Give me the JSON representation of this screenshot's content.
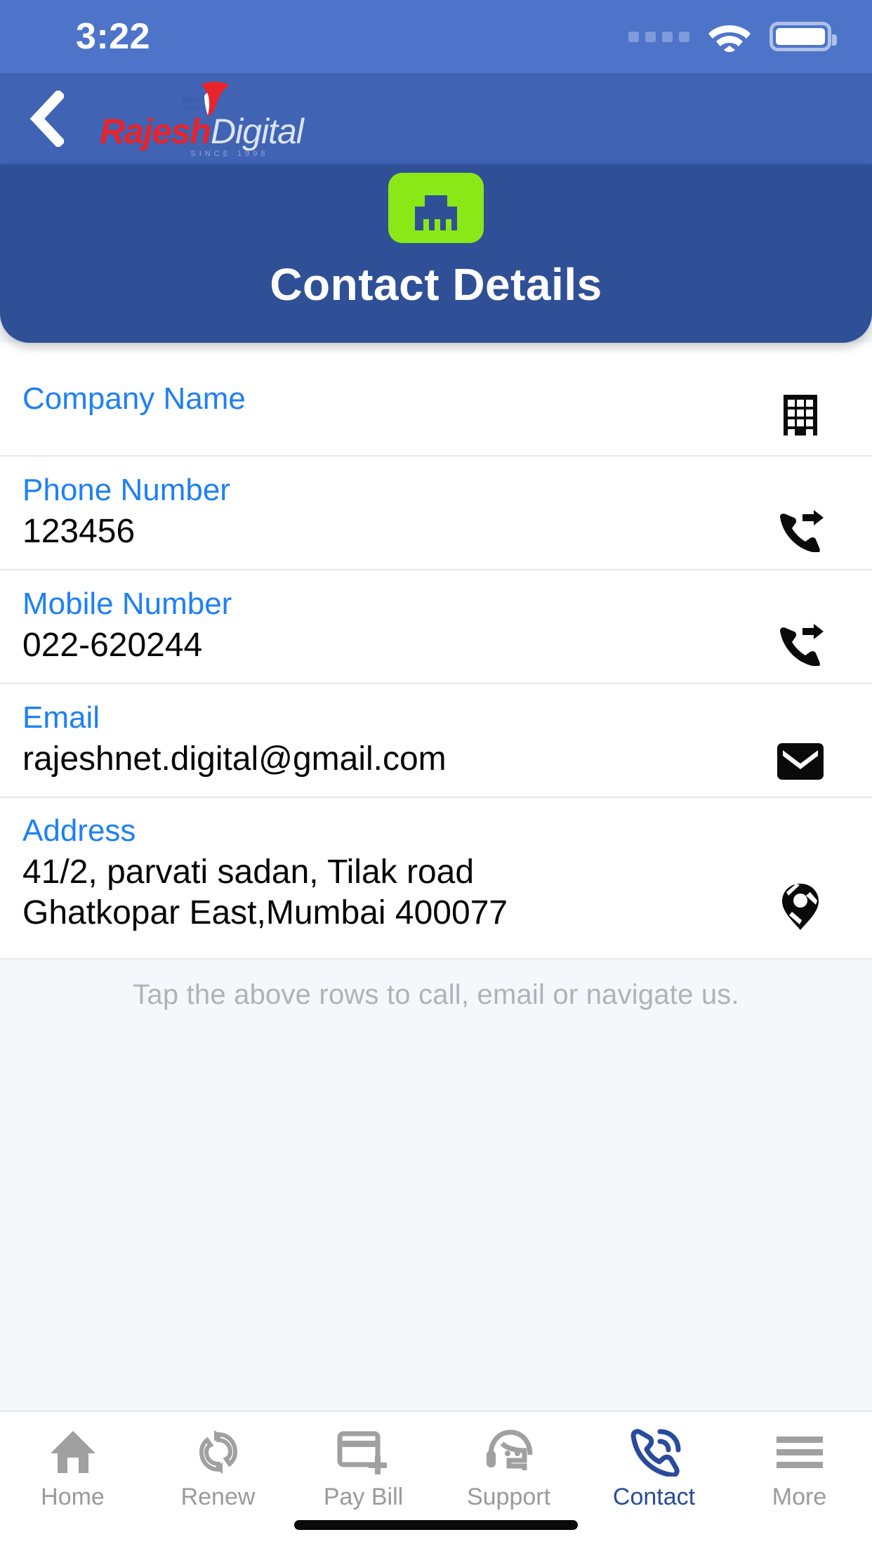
{
  "status_bar": {
    "time": "3:22",
    "signal_icon": "signal-dots-icon",
    "wifi_icon": "wifi-icon",
    "battery_icon": "battery-full-icon"
  },
  "navbar": {
    "back_icon": "back-chevron-icon",
    "brand_primary": "Rajesh",
    "brand_secondary": "Digital",
    "brand_tagline": "SINCE 1998",
    "brand_mark_icon": "swoosh-logo-icon"
  },
  "header": {
    "page_icon": "ethernet-port-icon",
    "title": "Contact Details",
    "icon_color": "#8BE817",
    "panel_color": "#2F5096",
    "navbar_color": "#4063B4",
    "statusbar_color": "#4D74C8"
  },
  "contact_rows": [
    {
      "label": "Company Name",
      "value": "",
      "icon": "building-icon"
    },
    {
      "label": "Phone Number",
      "value": "123456",
      "icon": "phone-forward-icon"
    },
    {
      "label": "Mobile Number",
      "value": "022-620244",
      "icon": "phone-forward-icon"
    },
    {
      "label": "Email",
      "value": "rajeshnet.digital@gmail.com",
      "icon": "envelope-icon"
    },
    {
      "label": "Address",
      "value": "41/2, parvati sadan, Tilak road\nGhatkopar East,Mumbai 400077",
      "icon": "map-pin-icon"
    }
  ],
  "hint": "Tap the above rows to call, email or navigate us.",
  "colors": {
    "label_blue": "#1E80F5",
    "hint_gray": "#ADB3B8",
    "tab_inactive": "#9A9A9A",
    "tab_active": "#2A4B9B",
    "page_bg": "#F4F8FB"
  },
  "tabs": [
    {
      "label": "Home",
      "icon": "home-icon",
      "active": false
    },
    {
      "label": "Renew",
      "icon": "refresh-icon",
      "active": false
    },
    {
      "label": "Pay Bill",
      "icon": "card-plus-icon",
      "active": false
    },
    {
      "label": "Support",
      "icon": "headset-icon",
      "active": false
    },
    {
      "label": "Contact",
      "icon": "phone-ring-icon",
      "active": true
    },
    {
      "label": "More",
      "icon": "hamburger-icon",
      "active": false
    }
  ]
}
